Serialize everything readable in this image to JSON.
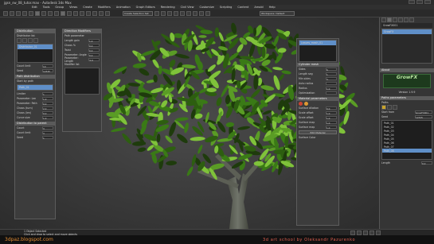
{
  "window": {
    "title": "jgsn_sw_08_tutor.max - Autodesk 3ds Max"
  },
  "menu": [
    "Edit",
    "Tools",
    "Group",
    "Views",
    "Create",
    "Modifiers",
    "Animation",
    "Graph Editors",
    "Rendering",
    "Civil View",
    "Customize",
    "Scripting",
    "Content",
    "Arnold",
    "Help"
  ],
  "toolbar": {
    "selection_set": "Create Selection Set",
    "workspace": "Workspace: Default"
  },
  "panel_distribution": {
    "title": "Distribution",
    "subtitle": "Distributor list",
    "list_item": "Distributor_01",
    "rows": [
      {
        "label": "Count limit",
        "value": "10"
      },
      {
        "label": "Seed",
        "value": "12345"
      }
    ],
    "section2": "Path distribution",
    "section2_sub": "Start by path",
    "path_item": "Path_01",
    "rows2": [
      {
        "label": "Limiter",
        "value": "1"
      },
      {
        "label": "Parameter: Len",
        "value": "1.0"
      },
      {
        "label": "Parameter: Path",
        "value": "0.0"
      },
      {
        "label": "Chaos (turn)",
        "value": "2.0"
      },
      {
        "label": "Chaos (len)",
        "value": "0.0"
      },
      {
        "label": "Curve size",
        "value": "1.0"
      }
    ],
    "section3": "Distribution to parent",
    "rows3": [
      {
        "label": "Count",
        "value": "3"
      },
      {
        "label": "Count limit",
        "value": "3"
      },
      {
        "label": "Seed",
        "value": "1"
      }
    ]
  },
  "panel_direction": {
    "title": "Direction Modifiers",
    "subtitle": "Path parameter",
    "rows": [
      {
        "label": "Length gain",
        "value": "1.0"
      },
      {
        "label": "Chaos %",
        "value": "0.0"
      },
      {
        "label": "Twist",
        "value": "0.0"
      },
      {
        "label": "Parameter: Angle",
        "value": "0.0"
      },
      {
        "label": "Parameter: Length",
        "value": "0.0"
      }
    ],
    "modifier_list": "Modifier list"
  },
  "panel_cylinder": {
    "title": "Cylinder mesh",
    "list_item": "Leaves_mesh_01",
    "rows": [
      {
        "label": "Sides",
        "value": "6"
      },
      {
        "label": "Length seg",
        "value": "1"
      },
      {
        "label": "Min sides",
        "value": "3"
      },
      {
        "label": "Auto radius",
        "value": ""
      },
      {
        "label": "Radius",
        "value": "1.0"
      },
      {
        "label": "Optimization",
        "value": ""
      }
    ],
    "section2": "Material parameters",
    "rows2": [
      {
        "label": "Surface dilation",
        "value": "0.0"
      },
      {
        "label": "Scale offset",
        "value": "1.0"
      },
      {
        "label": "Scale offset",
        "value": "1.0"
      },
      {
        "label": "Surface map",
        "value": "1.0"
      },
      {
        "label": "Surface map",
        "value": "1.0"
      }
    ],
    "btn": "Edit Material",
    "bottom": "Surface Color"
  },
  "command_panel": {
    "object_name": "GrowFX001",
    "modifier_item": "GrowFX",
    "about_title": "About",
    "logo_text": "GrowFX",
    "version": "Version 1.9.9",
    "section": "Paths parameters",
    "section_sub": "Paths",
    "path_items": [
      "Path_01",
      "Path_02",
      "Path_03",
      "Path_04",
      "Path_05",
      "Path_06",
      "Path_07",
      "Path_08"
    ],
    "selected_path": "Path_08",
    "start_label": "Start from",
    "start_value": "GrowFX001",
    "seed_label": "Seed",
    "seed_value": "12345",
    "length_label": "Length",
    "length_value": "0.0"
  },
  "status": {
    "selection": "1 Object Selected",
    "hint": "Click and drag to select and move objects"
  },
  "footer": {
    "left": "3dpaz.blogspot.com",
    "right": "3d art school by Oleksandr Pazurenko"
  },
  "colors": {
    "leaf_dark": "#1e3b0c",
    "leaf_mid": "#3a7a16",
    "leaf_light": "#7fc23a",
    "trunk": "#5c5f55",
    "accent": "#e08b33"
  }
}
